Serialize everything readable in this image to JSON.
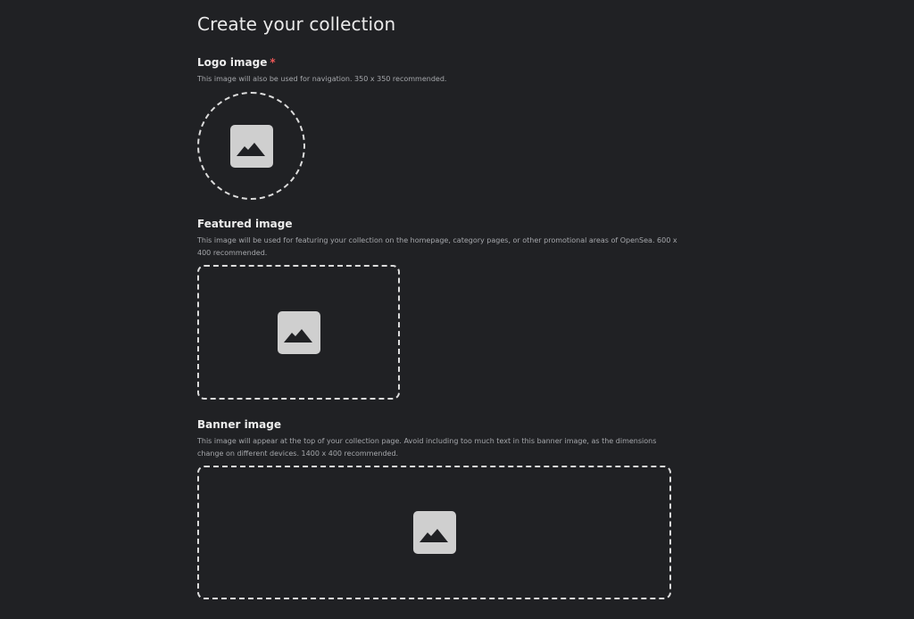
{
  "page": {
    "title": "Create your collection"
  },
  "logo": {
    "label": "Logo image",
    "required_mark": "*",
    "description": "This image will also be used for navigation. 350 x 350 recommended."
  },
  "featured": {
    "label": "Featured image",
    "description": "This image will be used for featuring your collection on the homepage, category pages, or other promotional areas of OpenSea. 600 x 400 recommended."
  },
  "banner": {
    "label": "Banner image",
    "description": "This image will appear at the top of your collection page. Avoid including too much text in this banner image, as the dimensions change on different devices. 1400 x 400 recommended."
  },
  "icons": {
    "upload_placeholder": "image-placeholder-icon"
  },
  "colors": {
    "background": "#202124",
    "required": "#eb5757",
    "dashed_border": "#dcdcdc",
    "icon_fill": "#cfcfcf"
  }
}
